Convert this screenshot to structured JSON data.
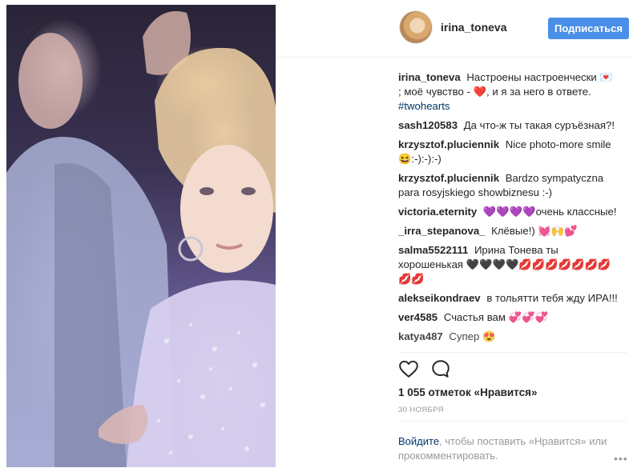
{
  "header": {
    "username": "irina_toneva",
    "follow_label": "Подписаться"
  },
  "comments": [
    {
      "user": "irina_toneva",
      "text": "Настроены настроенчески 💌 ; моё чувство - ❤️, и я за него в ответе.",
      "hashtag": "#twohearts"
    },
    {
      "user": "sash120583",
      "text": "Да что-ж ты такая суръёзная?!"
    },
    {
      "user": "krzysztof.pluciennik",
      "text": "Nice photo-more smile 😆:-):-):-)"
    },
    {
      "user": "krzysztof.pluciennik",
      "text": "Bardzo sympatyczna para rosyjskiego showbiznesu :-)"
    },
    {
      "user": "victoria.eternity",
      "text": "💜💜💜💜очень классные!"
    },
    {
      "user": "_irra_stepanova_",
      "text": "Клёвые!) 💓🙌💕"
    },
    {
      "user": "salma5522111",
      "text": "Ирина Тонева ты хорошенькая 🖤🖤🖤🖤💋💋💋💋💋💋💋💋💋"
    },
    {
      "user": "alekseikondraev",
      "text": "в тольятти тебя жду ИРА!!!"
    },
    {
      "user": "ver4585",
      "text": "Счастья вам 💞💞💞"
    },
    {
      "user": "katya487",
      "text": "Супер 😍"
    }
  ],
  "actions": {
    "like_icon": "heart-outline-icon",
    "comment_icon": "speech-bubble-icon"
  },
  "likes_text": "1 055 отметок «Нравится»",
  "date": "30 НОЯБРЯ",
  "login": {
    "link": "Войдите",
    "rest": ", чтобы поставить «Нравится» или прокомментировать."
  },
  "more_label": "•••",
  "colors": {
    "follow_button": "#4a8fe7",
    "link": "#003569",
    "muted": "#999999"
  }
}
